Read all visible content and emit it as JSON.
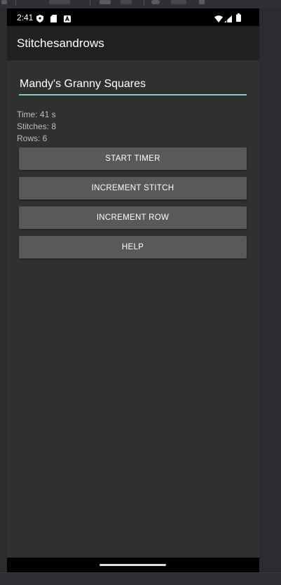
{
  "status_bar": {
    "time": "2:41",
    "icons": [
      "shield-icon",
      "sd-card-icon",
      "notification-icon",
      "wifi-icon",
      "signal-icon",
      "battery-icon"
    ]
  },
  "app_bar": {
    "title": "Stitchesandrows"
  },
  "project": {
    "name_value": "Mandy's Granny Squares"
  },
  "stats": {
    "time": "Time: 41 s",
    "stitches": "Stitches: 8",
    "rows": "Rows: 6"
  },
  "buttons": {
    "start_timer": "START TIMER",
    "increment_stitch": "INCREMENT STITCH",
    "increment_row": "INCREMENT ROW",
    "help": "HELP"
  },
  "colors": {
    "accent": "#80cbc4",
    "app_bar": "#212121",
    "background": "#303030",
    "button": "#595959"
  }
}
